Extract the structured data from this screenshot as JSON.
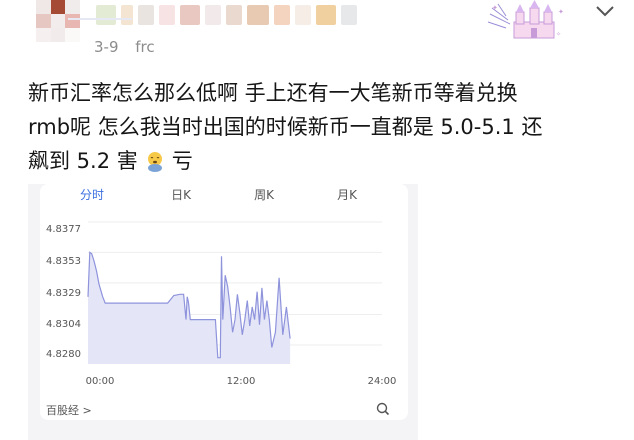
{
  "post": {
    "meta": {
      "date": "3-9",
      "source_fragment": "frc"
    },
    "text_line1": "新币汇率怎么那么低啊 手上还有一大笔新币等着兑换",
    "text_line2": "rmb呢 怎么我当时出国的时候新币一直都是 5.0-5.1 还",
    "text_line3a": "飙到 5.2 害",
    "text_line3b": "亏",
    "emoji_icon": "tired-face-emoji"
  },
  "widget": {
    "tabs": [
      {
        "label": "分时",
        "active": true
      },
      {
        "label": "日K",
        "active": false
      },
      {
        "label": "周K",
        "active": false
      },
      {
        "label": "月K",
        "active": false
      }
    ],
    "source_link": "百股经 >",
    "search_icon": "search-icon",
    "accent_color": "#3b6fe0"
  },
  "chart_data": {
    "type": "area",
    "y_tick_labels": [
      "4.8377",
      "4.8353",
      "4.8329",
      "4.8304",
      "4.8280"
    ],
    "x_tick_labels": [
      "00:00",
      "12:00",
      "24:00"
    ],
    "ylim": [
      4.8265,
      4.8377
    ],
    "xlim": [
      0,
      24
    ],
    "series": [
      {
        "x": [
          0.0,
          0.15,
          0.3,
          0.5,
          0.7,
          0.9,
          1.2,
          1.4,
          1.6,
          1.8,
          2.0,
          2.2,
          2.5,
          3.0,
          3.5,
          4.0,
          4.5,
          5.0,
          5.5,
          6.0,
          6.5,
          7.0,
          7.5,
          7.8,
          8.0,
          8.1,
          8.2,
          8.35,
          8.5,
          8.7,
          9.0,
          9.2,
          9.4,
          9.6,
          9.8,
          10.0,
          10.2,
          10.4,
          10.6,
          10.8,
          10.9,
          11.0,
          11.2,
          11.4,
          11.6,
          11.8,
          12.0,
          12.2,
          12.4,
          12.6,
          12.8,
          13.0,
          13.2,
          13.4,
          13.6,
          13.8,
          14.0,
          14.2,
          14.4,
          14.6,
          14.8,
          15.0,
          15.3,
          15.6,
          15.9,
          16.2,
          16.5
        ],
        "y": [
          4.8318,
          4.8353,
          4.8352,
          4.8346,
          4.8338,
          4.8328,
          4.8318,
          4.8313,
          4.8313,
          4.8313,
          4.8313,
          4.8313,
          4.8313,
          4.8313,
          4.8313,
          4.8313,
          4.8313,
          4.8313,
          4.8313,
          4.8313,
          4.8313,
          4.8319,
          4.832,
          4.832,
          4.83,
          4.8318,
          4.8314,
          4.83,
          4.83,
          4.83,
          4.83,
          4.83,
          4.83,
          4.83,
          4.83,
          4.83,
          4.83,
          4.83,
          4.827,
          4.827,
          4.835,
          4.83,
          4.8335,
          4.8326,
          4.831,
          4.829,
          4.83,
          4.832,
          4.8305,
          4.8288,
          4.83,
          4.8315,
          4.8295,
          4.831,
          4.83,
          4.8322,
          4.8296,
          4.8325,
          4.83,
          4.8315,
          4.83,
          4.8278,
          4.829,
          4.8333,
          4.8288,
          4.831,
          4.8285
        ]
      }
    ],
    "line_color": "#8e93dc",
    "fill_color": "#e4e6f8",
    "grid": true
  }
}
